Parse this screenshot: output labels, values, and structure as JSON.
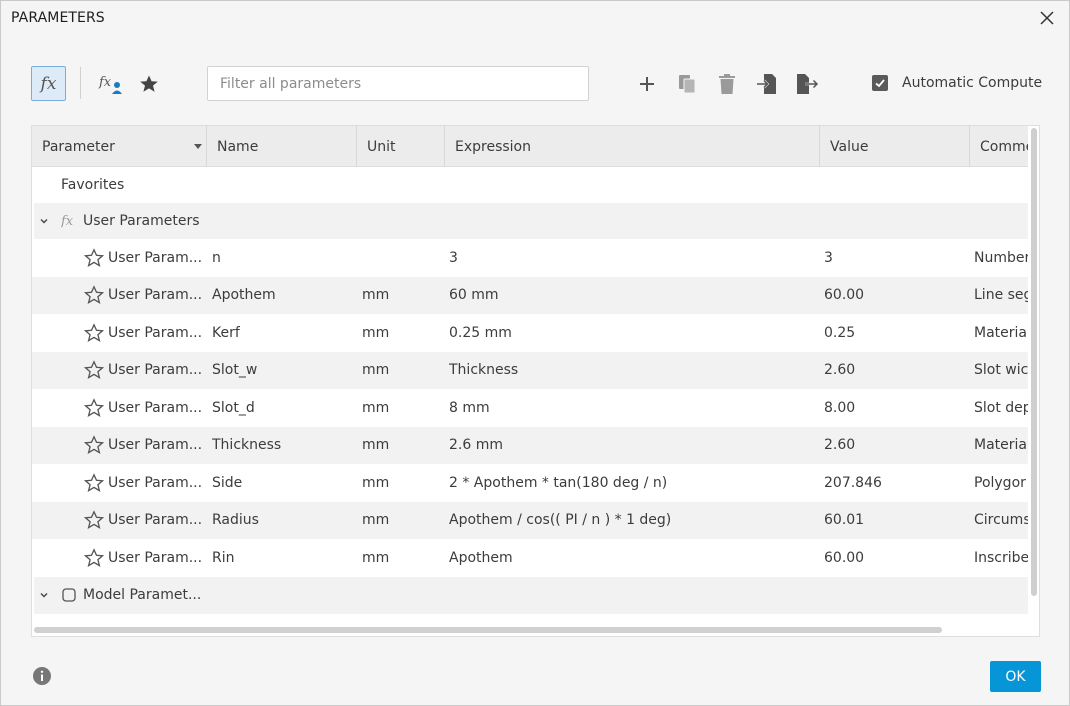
{
  "window": {
    "title": "PARAMETERS"
  },
  "toolbar": {
    "icons": [
      "fx-user-parameters-icon",
      "fx-user-add-icon",
      "favorite-star-icon",
      "add-icon",
      "copy-icon",
      "delete-icon",
      "import-icon",
      "export-icon"
    ],
    "search_placeholder": "Filter all parameters",
    "search_value": "",
    "auto_compute_label": "Automatic Compute",
    "auto_compute_checked": true
  },
  "table": {
    "columns": [
      "Parameter",
      "Name",
      "Unit",
      "Expression",
      "Value",
      "Comme"
    ],
    "favorites_label": "Favorites",
    "user_group_label": "User Parameters",
    "model_group_label": "Model Paramet...",
    "rows": [
      {
        "param": "User Param...",
        "name": "n",
        "unit": "",
        "expression": "3",
        "value": "3",
        "comment": "Number"
      },
      {
        "param": "User Param...",
        "name": "Apothem",
        "unit": "mm",
        "expression": "60 mm",
        "value": "60.00",
        "comment": "Line seg"
      },
      {
        "param": "User Param...",
        "name": "Kerf",
        "unit": "mm",
        "expression": "0.25 mm",
        "value": "0.25",
        "comment": "Materia"
      },
      {
        "param": "User Param...",
        "name": "Slot_w",
        "unit": "mm",
        "expression": "Thickness",
        "value": "2.60",
        "comment": "Slot wic"
      },
      {
        "param": "User Param...",
        "name": "Slot_d",
        "unit": "mm",
        "expression": "8 mm",
        "value": "8.00",
        "comment": "Slot dep"
      },
      {
        "param": "User Param...",
        "name": "Thickness",
        "unit": "mm",
        "expression": "2.6 mm",
        "value": "2.60",
        "comment": "Materia"
      },
      {
        "param": "User Param...",
        "name": "Side",
        "unit": "mm",
        "expression": "2 * Apothem * tan(180 deg / n)",
        "value": "207.846",
        "comment": "Polygor"
      },
      {
        "param": "User Param...",
        "name": "Radius",
        "unit": "mm",
        "expression": "Apothem / cos(( PI / n ) * 1 deg)",
        "value": "60.01",
        "comment": "Circums"
      },
      {
        "param": "User Param...",
        "name": "Rin",
        "unit": "mm",
        "expression": "Apothem",
        "value": "60.00",
        "comment": "Inscribe"
      }
    ]
  },
  "footer": {
    "ok_label": "OK"
  },
  "colors": {
    "accent": "#0696d7",
    "selected_bg": "#dcebf7",
    "row_alt": "#f2f2f2"
  }
}
